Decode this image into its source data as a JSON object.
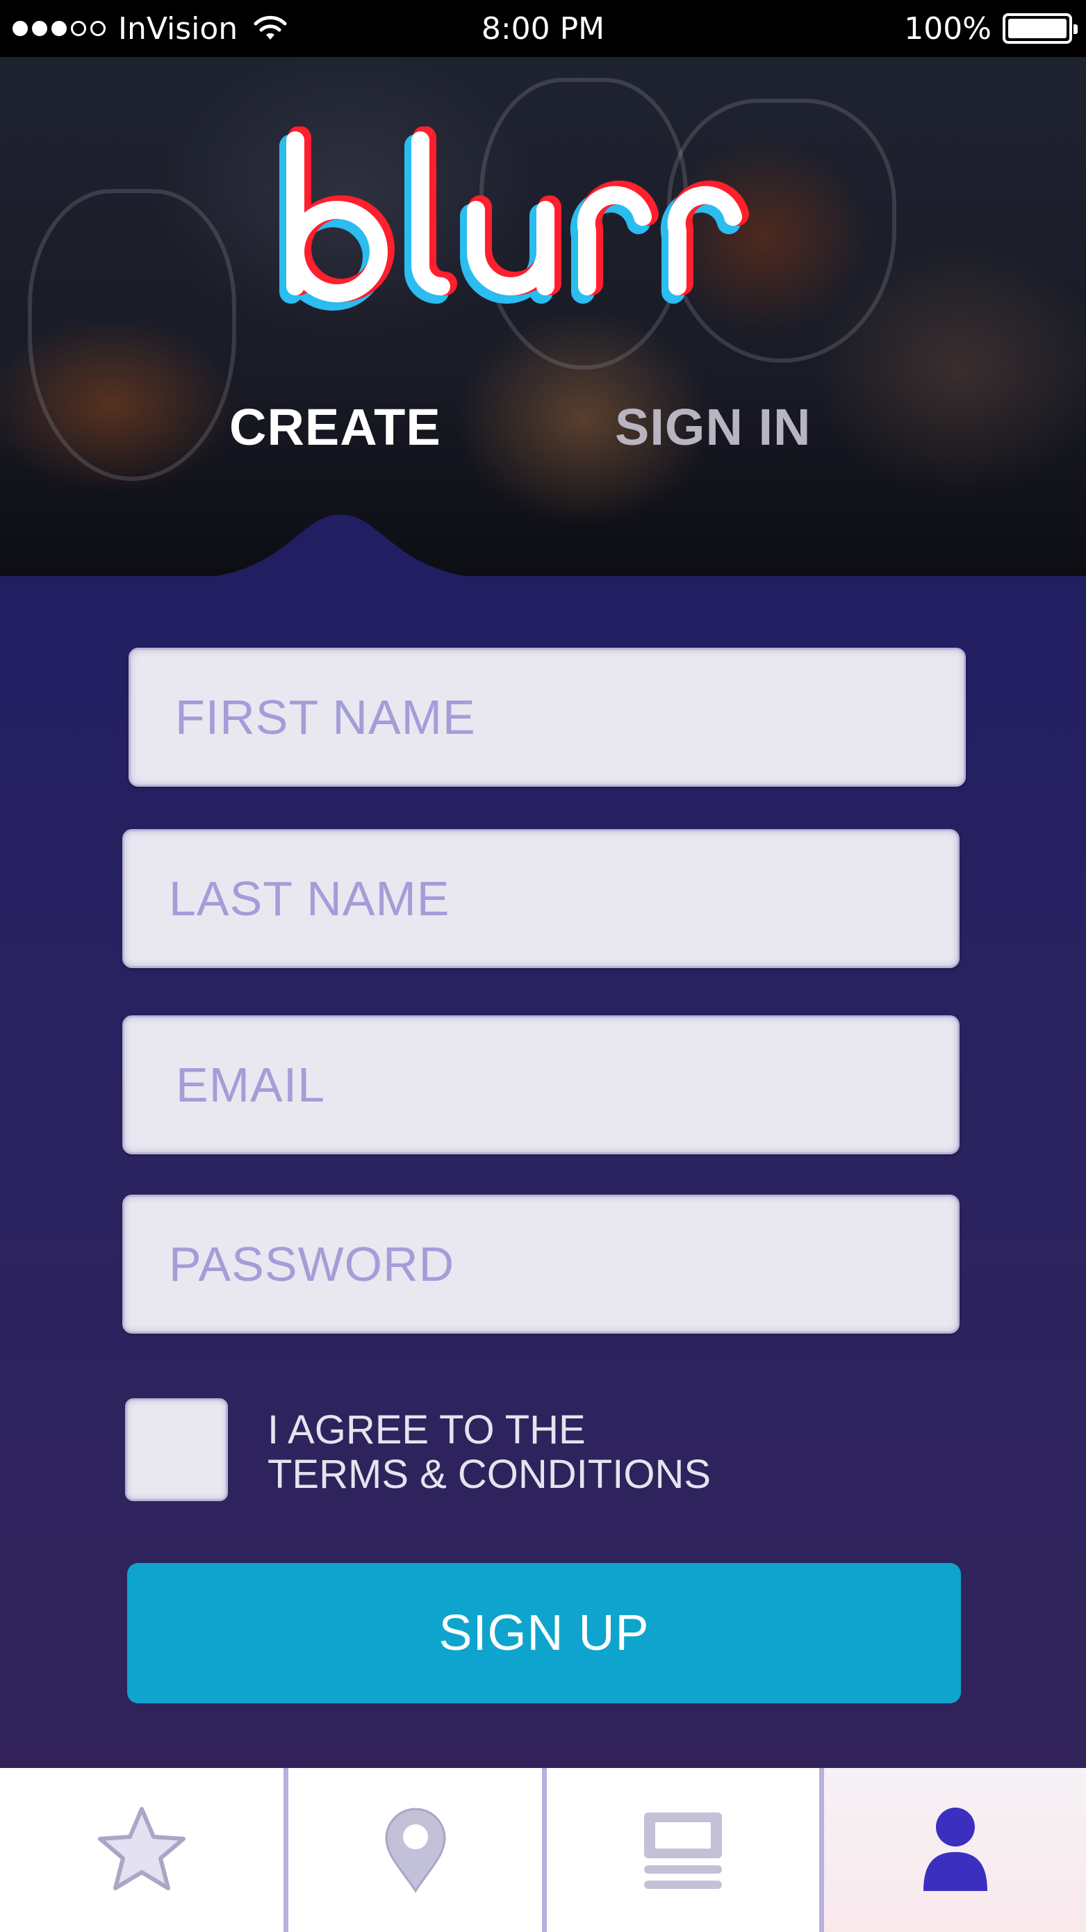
{
  "status_bar": {
    "carrier": "InVision",
    "time": "8:00 PM",
    "battery": "100%",
    "signal_bars_filled": 3,
    "signal_bars_total": 5
  },
  "hero": {
    "logo_text": "blurr",
    "tabs": [
      {
        "label": "CREATE",
        "active": true
      },
      {
        "label": "SIGN IN",
        "active": false
      }
    ]
  },
  "form": {
    "first_name_placeholder": "FIRST NAME",
    "last_name_placeholder": "LAST NAME",
    "email_placeholder": "EMAIL",
    "password_placeholder": "PASSWORD",
    "terms_line1": "I AGREE TO THE",
    "terms_line2": "TERMS & CONDITIONS",
    "terms_checked": false,
    "submit_label": "SIGN UP"
  },
  "tab_bar": {
    "items": [
      {
        "icon": "star-icon",
        "active": false
      },
      {
        "icon": "map-pin-icon",
        "active": false
      },
      {
        "icon": "feed-icon",
        "active": false
      },
      {
        "icon": "user-icon",
        "active": true
      }
    ]
  },
  "colors": {
    "panel": "#221e62",
    "accent": "#0ea4ce",
    "placeholder": "#a39ed8",
    "inactive_icon": "#c3c1d8",
    "active_icon": "#3b2fbf",
    "logo_red": "#ff1f2d",
    "logo_blue": "#2bbcf0"
  }
}
